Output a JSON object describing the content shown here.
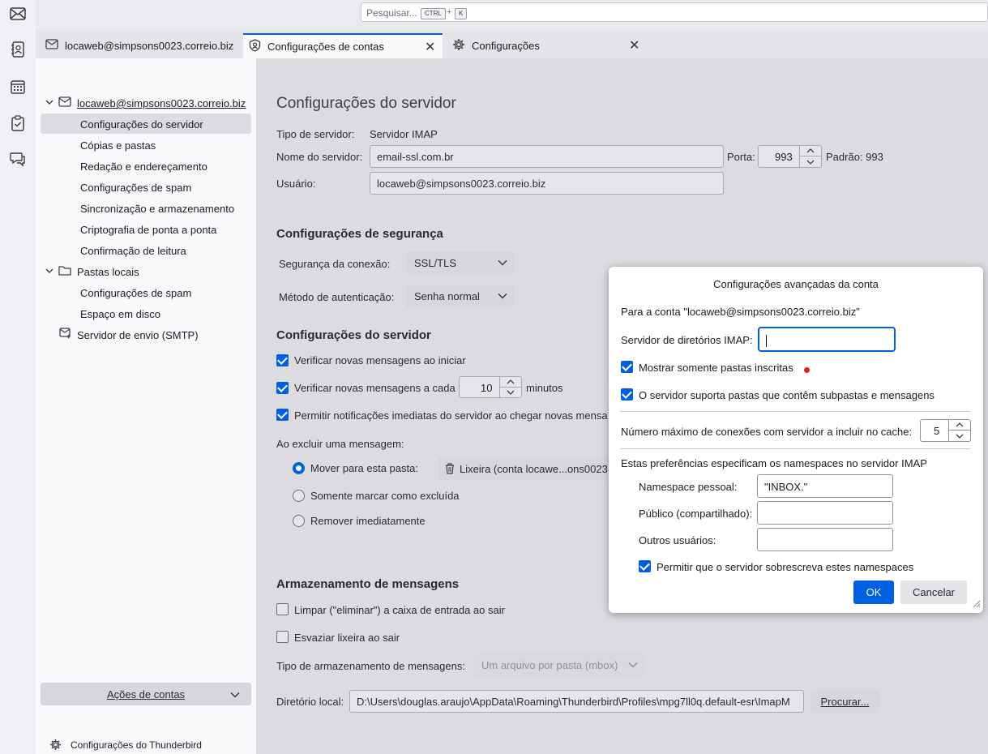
{
  "search": {
    "placeholder": "Pesquisar...",
    "key1": "CTRL",
    "plus": "+",
    "key2": "K"
  },
  "spaces": {
    "items": [
      "mail-icon",
      "address-book-icon",
      "calendar-icon",
      "tasks-icon",
      "chat-icon"
    ]
  },
  "tabs": [
    {
      "label": "locaweb@simpsons0023.correio.biz",
      "icon": "mail-account-icon"
    },
    {
      "label": "Configurações de contas",
      "icon": "account-settings-icon",
      "active": true
    },
    {
      "label": "Configurações",
      "icon": "gear-icon"
    }
  ],
  "tree": {
    "account": "locaweb@simpsons0023.correio.biz",
    "account_items": [
      "Configurações do servidor",
      "Cópias e pastas",
      "Redação e endereçamento",
      "Configurações de spam",
      "Sincronização e armazenamento",
      "Criptografia de ponta a ponta",
      "Confirmação de leitura"
    ],
    "local": "Pastas locais",
    "local_items": [
      "Configurações de spam",
      "Espaço em disco"
    ],
    "smtp": "Servidor de envio (SMTP)",
    "actions": "Ações de contas",
    "tb_settings": "Configurações do Thunderbird"
  },
  "server": {
    "title": "Configurações do servidor",
    "type_label": "Tipo de servidor:",
    "type_value": "Servidor IMAP",
    "name_label": "Nome do servidor:",
    "name_value": "email-ssl.com.br",
    "port_label": "Porta:",
    "port_value": "993",
    "default_label": "Padrão: 993",
    "user_label": "Usuário:",
    "user_value": "locaweb@simpsons0023.correio.biz"
  },
  "security": {
    "title": "Configurações de segurança",
    "conn_label": "Segurança da conexão:",
    "conn_value": "SSL/TLS",
    "auth_label": "Método de autenticação:",
    "auth_value": "Senha normal"
  },
  "server_settings": {
    "title": "Configurações do servidor",
    "check_startup": "Verificar novas mensagens ao iniciar",
    "check_every": "Verificar novas mensagens a cada",
    "minutes_value": "10",
    "minutes_label": "minutos",
    "push": "Permitir notificações imediatas do servidor ao chegar novas mensa",
    "on_delete": "Ao excluir uma mensagem:",
    "move_to": "Mover para esta pasta:",
    "trash_folder": "Lixeira (conta locawe...ons0023.c",
    "mark_deleted": "Somente marcar como excluída",
    "remove_now": "Remover imediatamente"
  },
  "storage": {
    "title": "Armazenamento de mensagens",
    "clean_inbox": "Limpar (\"eliminar\") a caixa de entrada ao sair",
    "empty_trash": "Esvaziar lixeira ao sair",
    "type_label": "Tipo de armazenamento de mensagens:",
    "type_value": "Um arquivo por pasta (mbox)",
    "dir_label": "Diretório local:",
    "dir_value": "D:\\Users\\douglas.araujo\\AppData\\Roaming\\Thunderbird\\Profiles\\mpg7ll0q.default-esr\\ImapM",
    "browse": "Procurar..."
  },
  "dialog": {
    "title": "Configurações avançadas da conta",
    "for_account": "Para a conta \"locaweb@simpsons0023.correio.biz\"",
    "imap_dir_label": "Servidor de diretórios IMAP:",
    "imap_dir_value": "",
    "show_subscribed": "Mostrar somente pastas inscritas",
    "supports_subfolders": "O servidor suporta pastas que contêm subpastas e mensagens",
    "max_conn_label": "Número máximo de conexões com servidor a incluir no cache:",
    "max_conn_value": "5",
    "namespaces_intro": "Estas preferências especificam os namespaces no servidor IMAP",
    "personal_label": "Namespace pessoal:",
    "personal_value": "\"INBOX.\"",
    "public_label": "Público (compartilhado):",
    "public_value": "",
    "others_label": "Outros usuários:",
    "others_value": "",
    "override": "Permitir que o servidor sobrescreva estes namespaces",
    "ok": "OK",
    "cancel": "Cancelar"
  },
  "colors": {
    "accent": "#0060df",
    "red_dot": "#e22850"
  }
}
